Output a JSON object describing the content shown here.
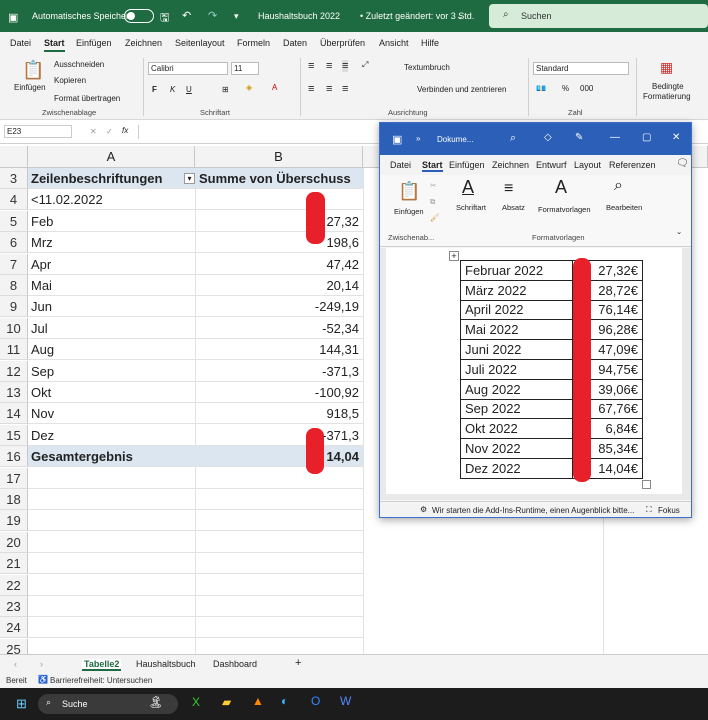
{
  "excel": {
    "titlebar": {
      "autosave_label": "Automatisches Speichern",
      "file_title": "Haushaltsbuch 2022",
      "modified": "• Zuletzt geändert: vor 3 Std.",
      "search_placeholder": "Suchen"
    },
    "menu": [
      "Datei",
      "Start",
      "Einfügen",
      "Zeichnen",
      "Seitenlayout",
      "Formeln",
      "Daten",
      "Überprüfen",
      "Ansicht",
      "Hilfe"
    ],
    "ribbon": {
      "paste": "Einfügen",
      "cut": "Ausschneiden",
      "copy": "Kopieren",
      "format_painter": "Format übertragen",
      "clipboard_group": "Zwischenablage",
      "font_name": "Calibri",
      "font_size": "11",
      "font_group": "Schriftart",
      "wrap_text": "Textumbruch",
      "merge_center": "Verbinden und zentrieren",
      "alignment_group": "Ausrichtung",
      "number_format": "Standard",
      "number_group": "Zahl",
      "cond_format_1": "Bedingte",
      "cond_format_2": "Formatierung"
    },
    "formula_bar": {
      "name_box": "E23",
      "fx": "fx"
    },
    "columns": [
      "A",
      "B"
    ],
    "rows": [
      {
        "n": "3",
        "a": "Zeilenbeschriftungen",
        "b": "Summe von Überschuss",
        "header": true
      },
      {
        "n": "4",
        "a": "<11.02.2022",
        "b": ""
      },
      {
        "n": "5",
        "a": "Feb",
        "b": "27,32"
      },
      {
        "n": "6",
        "a": "Mrz",
        "b": "198,6"
      },
      {
        "n": "7",
        "a": "Apr",
        "b": "47,42"
      },
      {
        "n": "8",
        "a": "Mai",
        "b": "20,14"
      },
      {
        "n": "9",
        "a": "Jun",
        "b": "-249,19"
      },
      {
        "n": "10",
        "a": "Jul",
        "b": "-52,34"
      },
      {
        "n": "11",
        "a": "Aug",
        "b": "144,31"
      },
      {
        "n": "12",
        "a": "Sep",
        "b": "-371,3"
      },
      {
        "n": "13",
        "a": "Okt",
        "b": "-100,92"
      },
      {
        "n": "14",
        "a": "Nov",
        "b": "918,5"
      },
      {
        "n": "15",
        "a": "Dez",
        "b": "-371,3"
      },
      {
        "n": "16",
        "a": "Gesamtergebnis",
        "b": "14,04",
        "total": true
      },
      {
        "n": "17",
        "a": "",
        "b": ""
      },
      {
        "n": "18",
        "a": "",
        "b": ""
      },
      {
        "n": "19",
        "a": "",
        "b": ""
      },
      {
        "n": "20",
        "a": "",
        "b": ""
      },
      {
        "n": "21",
        "a": "",
        "b": ""
      },
      {
        "n": "22",
        "a": "",
        "b": ""
      },
      {
        "n": "23",
        "a": "",
        "b": ""
      },
      {
        "n": "24",
        "a": "",
        "b": ""
      },
      {
        "n": "25",
        "a": "",
        "b": ""
      }
    ],
    "sheet_tabs": [
      "Tabelle2",
      "Haushaltsbuch",
      "Dashboard"
    ],
    "status": {
      "ready": "Bereit",
      "accessibility": "Barrierefreiheit: Untersuchen"
    }
  },
  "word": {
    "title": "Dokume...",
    "menu": [
      "Datei",
      "Start",
      "Einfügen",
      "Zeichnen",
      "Entwurf",
      "Layout",
      "Referenzen"
    ],
    "ribbon": {
      "paste": "Einfügen",
      "font": "Schriftart",
      "paragraph": "Absatz",
      "styles": "Formatvorlagen",
      "edit": "Bearbeiten",
      "clipboard_group": "Zwischenab...",
      "styles_group": "Formatvorlagen"
    },
    "table": [
      [
        "Februar 2022",
        "27,32€"
      ],
      [
        "März 2022",
        "28,72€"
      ],
      [
        "April 2022",
        "76,14€"
      ],
      [
        "Mai 2022",
        "96,28€"
      ],
      [
        "Juni 2022",
        "47,09€"
      ],
      [
        "Juli 2022",
        "94,75€"
      ],
      [
        "Aug 2022",
        "39,06€"
      ],
      [
        "Sep 2022",
        "67,76€"
      ],
      [
        "Okt 2022",
        "6,84€"
      ],
      [
        "Nov 2022",
        "85,34€"
      ],
      [
        "Dez 2022",
        "14,04€"
      ]
    ],
    "status_text": "Wir starten die Add-Ins-Runtime, einen Augenblick bitte...",
    "focus": "Fokus"
  },
  "taskbar": {
    "search_placeholder": "Suche"
  },
  "colors": {
    "excel_green": "#1e6b41",
    "word_blue": "#2b5fb8",
    "pivot_header": "#dce6f1",
    "redaction": "#e8202a"
  }
}
